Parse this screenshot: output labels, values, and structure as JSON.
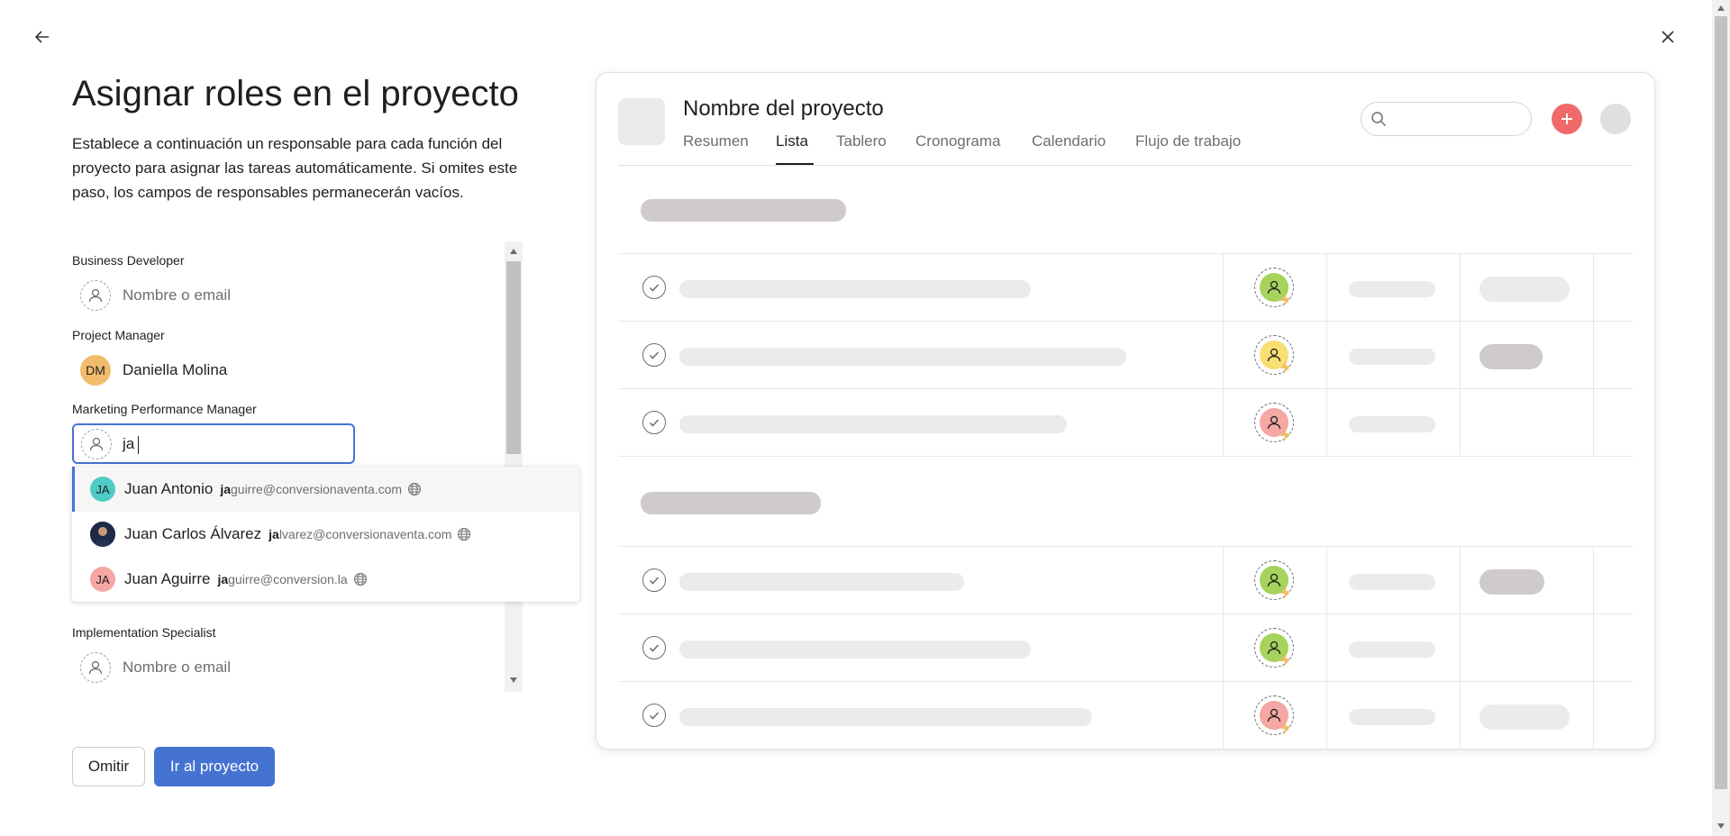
{
  "header": {
    "back_icon": "arrow-left-icon",
    "close_icon": "close-icon"
  },
  "form": {
    "title": "Asignar roles en el proyecto",
    "description": "Establece a continuación un responsable para cada función del proyecto para asignar las tareas automáticamente. Si omites este paso, los campos de responsables permanecerán vacíos.",
    "roles": [
      {
        "label": "Business Developer",
        "placeholder": "Nombre o email"
      },
      {
        "label": "Project Manager",
        "assignee": "Daniella Molina",
        "initials": "DM",
        "avatar_color": "#f1bd6c"
      },
      {
        "label": "Marketing Performance Manager",
        "input_value": "ja"
      },
      {
        "label": "Implementation Specialist",
        "placeholder": "Nombre o email"
      }
    ],
    "suggestions": [
      {
        "name": "Juan Antonio",
        "initials": "JA",
        "avatar_color": "#4ecbc4",
        "email_match": "ja",
        "email_rest": "guirre@conversionaventa.com"
      },
      {
        "name": "Juan Carlos Álvarez",
        "initials": "",
        "avatar_color": "#2b3a55",
        "email_match": "ja",
        "email_rest": "lvarez@conversionaventa.com"
      },
      {
        "name": "Juan Aguirre",
        "initials": "JA",
        "avatar_color": "#f4a7a3",
        "email_match": "ja",
        "email_rest": "guirre@conversion.la"
      }
    ],
    "buttons": {
      "skip": "Omitir",
      "go": "Ir al proyecto"
    }
  },
  "preview": {
    "project_title": "Nombre del proyecto",
    "tabs": [
      "Resumen",
      "Lista",
      "Tablero",
      "Cronograma",
      "Calendario",
      "Flujo de trabajo"
    ],
    "active_tab": "Lista"
  },
  "colors": {
    "primary": "#4573d2",
    "accent_red": "#f06a6a",
    "green": "#a6d35c",
    "yellow": "#f8df72",
    "pink": "#f4a7a3",
    "bolt": "#f1bd6c"
  }
}
